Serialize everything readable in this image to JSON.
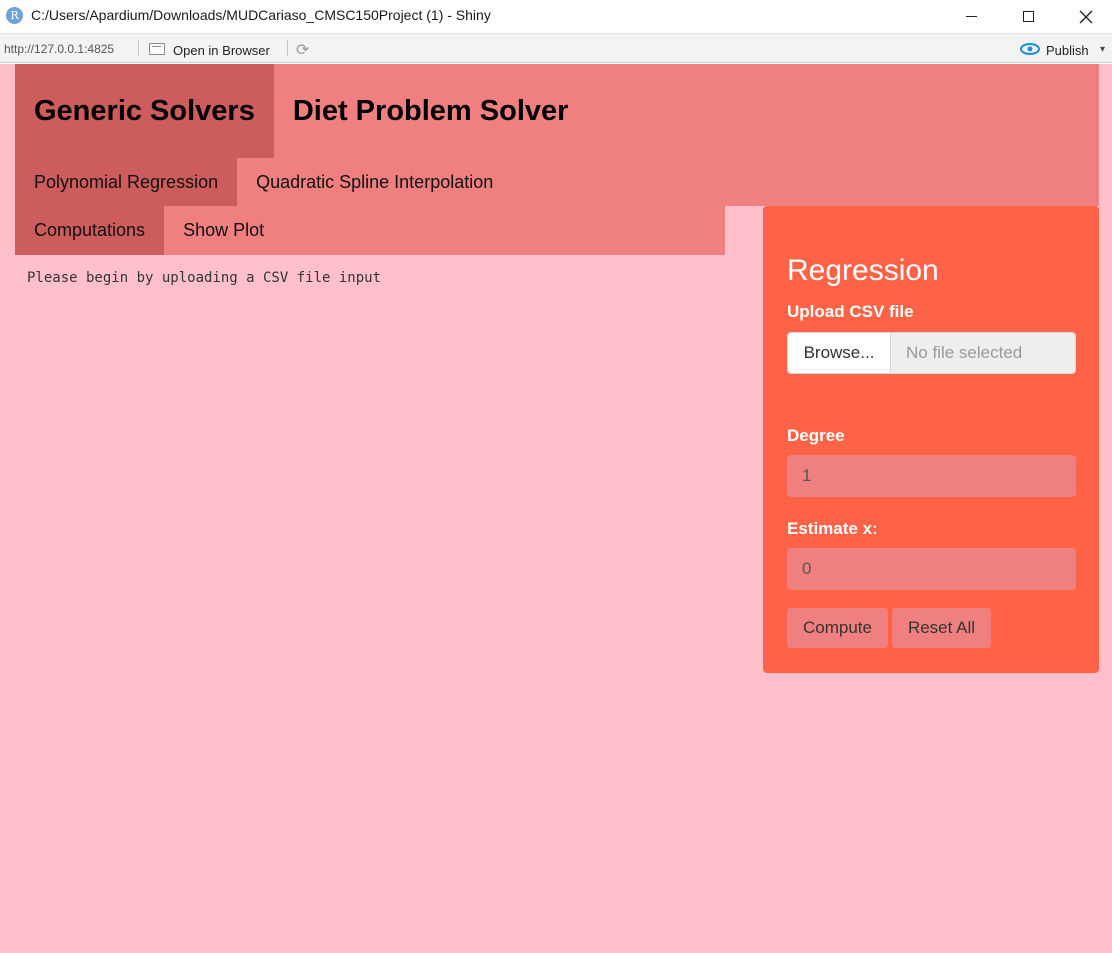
{
  "window": {
    "title": "C:/Users/Apardium/Downloads/MUDCariaso_CMSC150Project (1) - Shiny",
    "app_icon_letter": "R"
  },
  "toolbar": {
    "url": "http://127.0.0.1:4825",
    "open_in_browser": "Open in Browser",
    "publish": "Publish"
  },
  "navbar": {
    "main_tabs": [
      "Generic Solvers",
      "Diet Problem Solver"
    ],
    "sub_tabs": [
      "Polynomial Regression",
      "Quadratic Spline Interpolation"
    ]
  },
  "inner_tabs": [
    "Computations",
    "Show Plot"
  ],
  "output": {
    "message": "Please begin by uploading a CSV file input"
  },
  "panel": {
    "heading": "Regression",
    "upload_label": "Upload CSV file",
    "browse_label": "Browse...",
    "file_placeholder": "No file selected",
    "degree_label": "Degree",
    "degree_value": "1",
    "estimate_label": "Estimate x:",
    "estimate_value": "0",
    "compute_label": "Compute",
    "reset_label": "Reset All"
  },
  "colors": {
    "page_bg": "#ffc0cb",
    "navbar_bg": "#f08080",
    "active_tab": "#cd5c5c",
    "panel_bg": "#ff6347"
  }
}
